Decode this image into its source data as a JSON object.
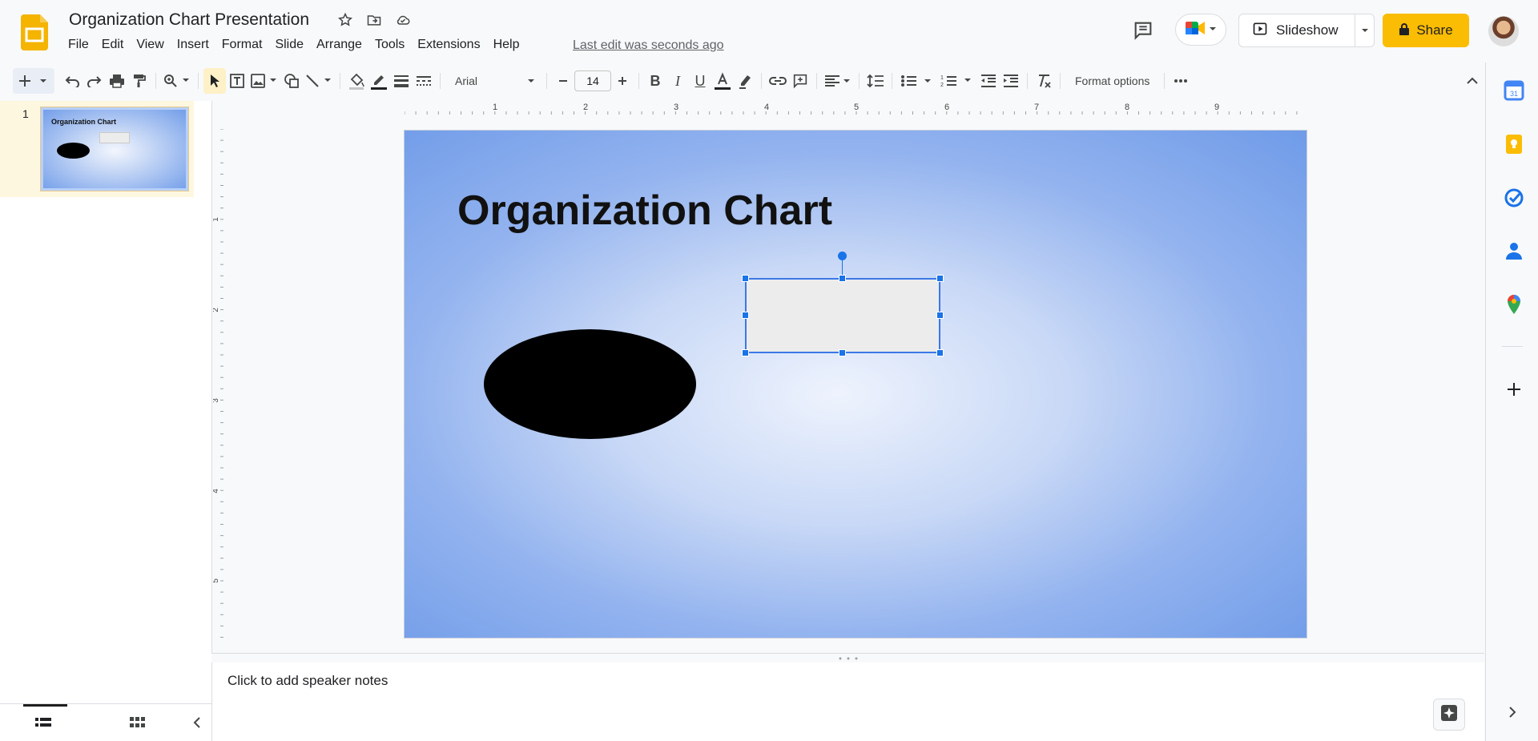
{
  "app": {
    "name": "Google Slides",
    "document_title": "Organization Chart Presentation",
    "last_edit": "Last edit was seconds ago"
  },
  "menu": [
    "File",
    "Edit",
    "View",
    "Insert",
    "Format",
    "Slide",
    "Arrange",
    "Tools",
    "Extensions",
    "Help"
  ],
  "header": {
    "slideshow_label": "Slideshow",
    "share_label": "Share"
  },
  "toolbar": {
    "font_name": "Arial",
    "font_size": "14",
    "format_options_label": "Format options"
  },
  "ruler": {
    "horizontal_labels": [
      "1",
      "2",
      "3",
      "4",
      "5",
      "6",
      "7",
      "8",
      "9"
    ],
    "vertical_labels": [
      "1",
      "2",
      "3",
      "4",
      "5"
    ]
  },
  "filmstrip": {
    "slides": [
      {
        "number": "1",
        "title": "Organization Chart"
      }
    ]
  },
  "slide": {
    "title": "Organization Chart"
  },
  "notes": {
    "placeholder": "Click to add speaker notes"
  },
  "colors": {
    "accent": "#1a73e8",
    "share": "#fbbc04",
    "slide_gradient_center": "#eef3fd",
    "slide_gradient_edge": "#6f9be8"
  }
}
